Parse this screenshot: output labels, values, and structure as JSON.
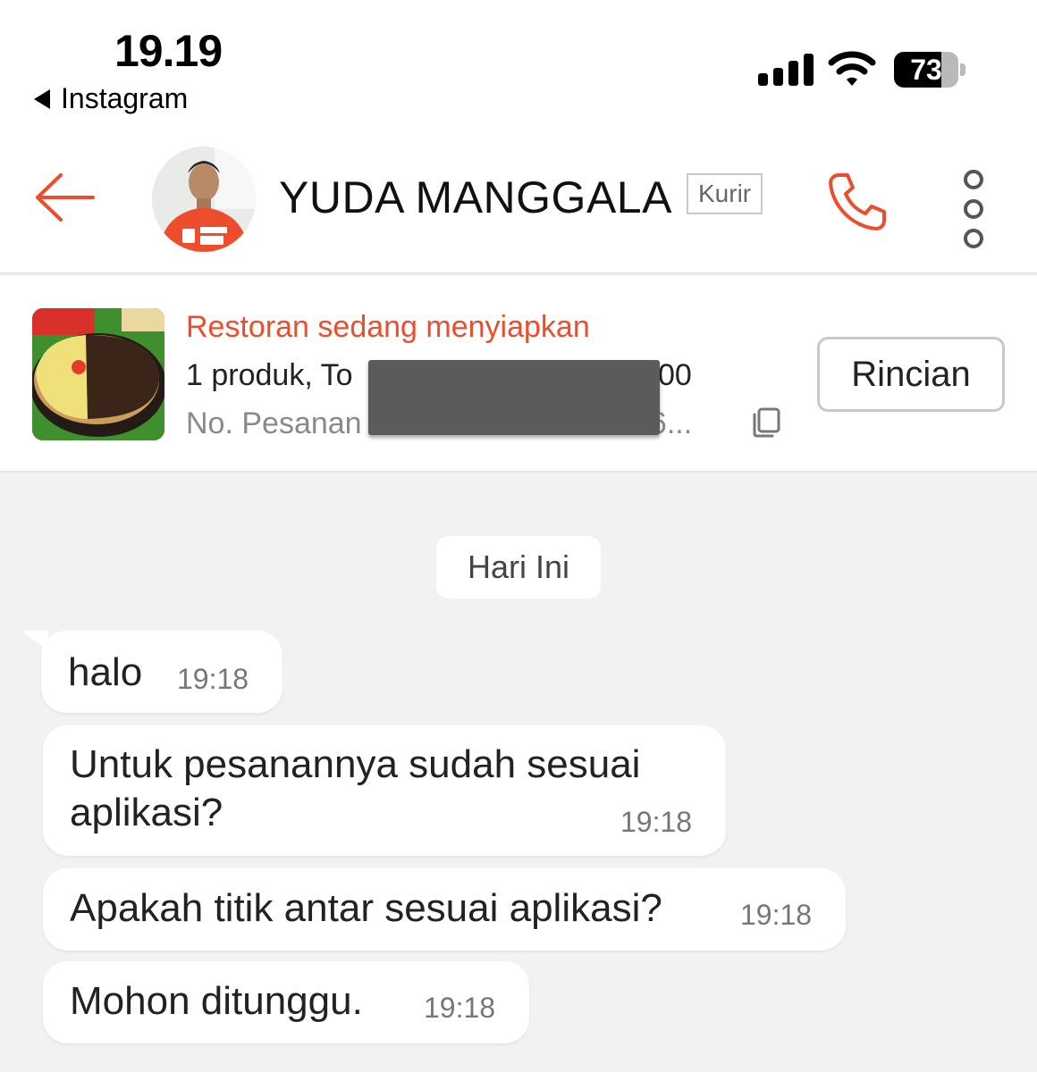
{
  "status_bar": {
    "time": "19.19",
    "back_app": "Instagram",
    "battery_percent": "73",
    "battery_level": 0.73
  },
  "header": {
    "name": "YUDA MANGGALA",
    "badge": "Kurir"
  },
  "order": {
    "status": "Restoran sedang menyiapkan",
    "summary_prefix": "1 produk, To",
    "summary_suffix": "00",
    "order_no_prefix": "No. Pesanan",
    "order_no_suffix": "46...",
    "details_button": "Rincian"
  },
  "chat": {
    "date_label": "Hari Ini",
    "messages": [
      {
        "text": "halo",
        "time": "19:18"
      },
      {
        "text": "Untuk pesanannya sudah sesuai aplikasi?",
        "time": "19:18"
      },
      {
        "text": "Apakah titik antar sesuai aplikasi?",
        "time": "19:18"
      },
      {
        "text": "Mohon ditunggu.",
        "time": "19:18"
      }
    ]
  },
  "colors": {
    "accent": "#ee4d2d",
    "chat_background": "#f2f2f2"
  }
}
